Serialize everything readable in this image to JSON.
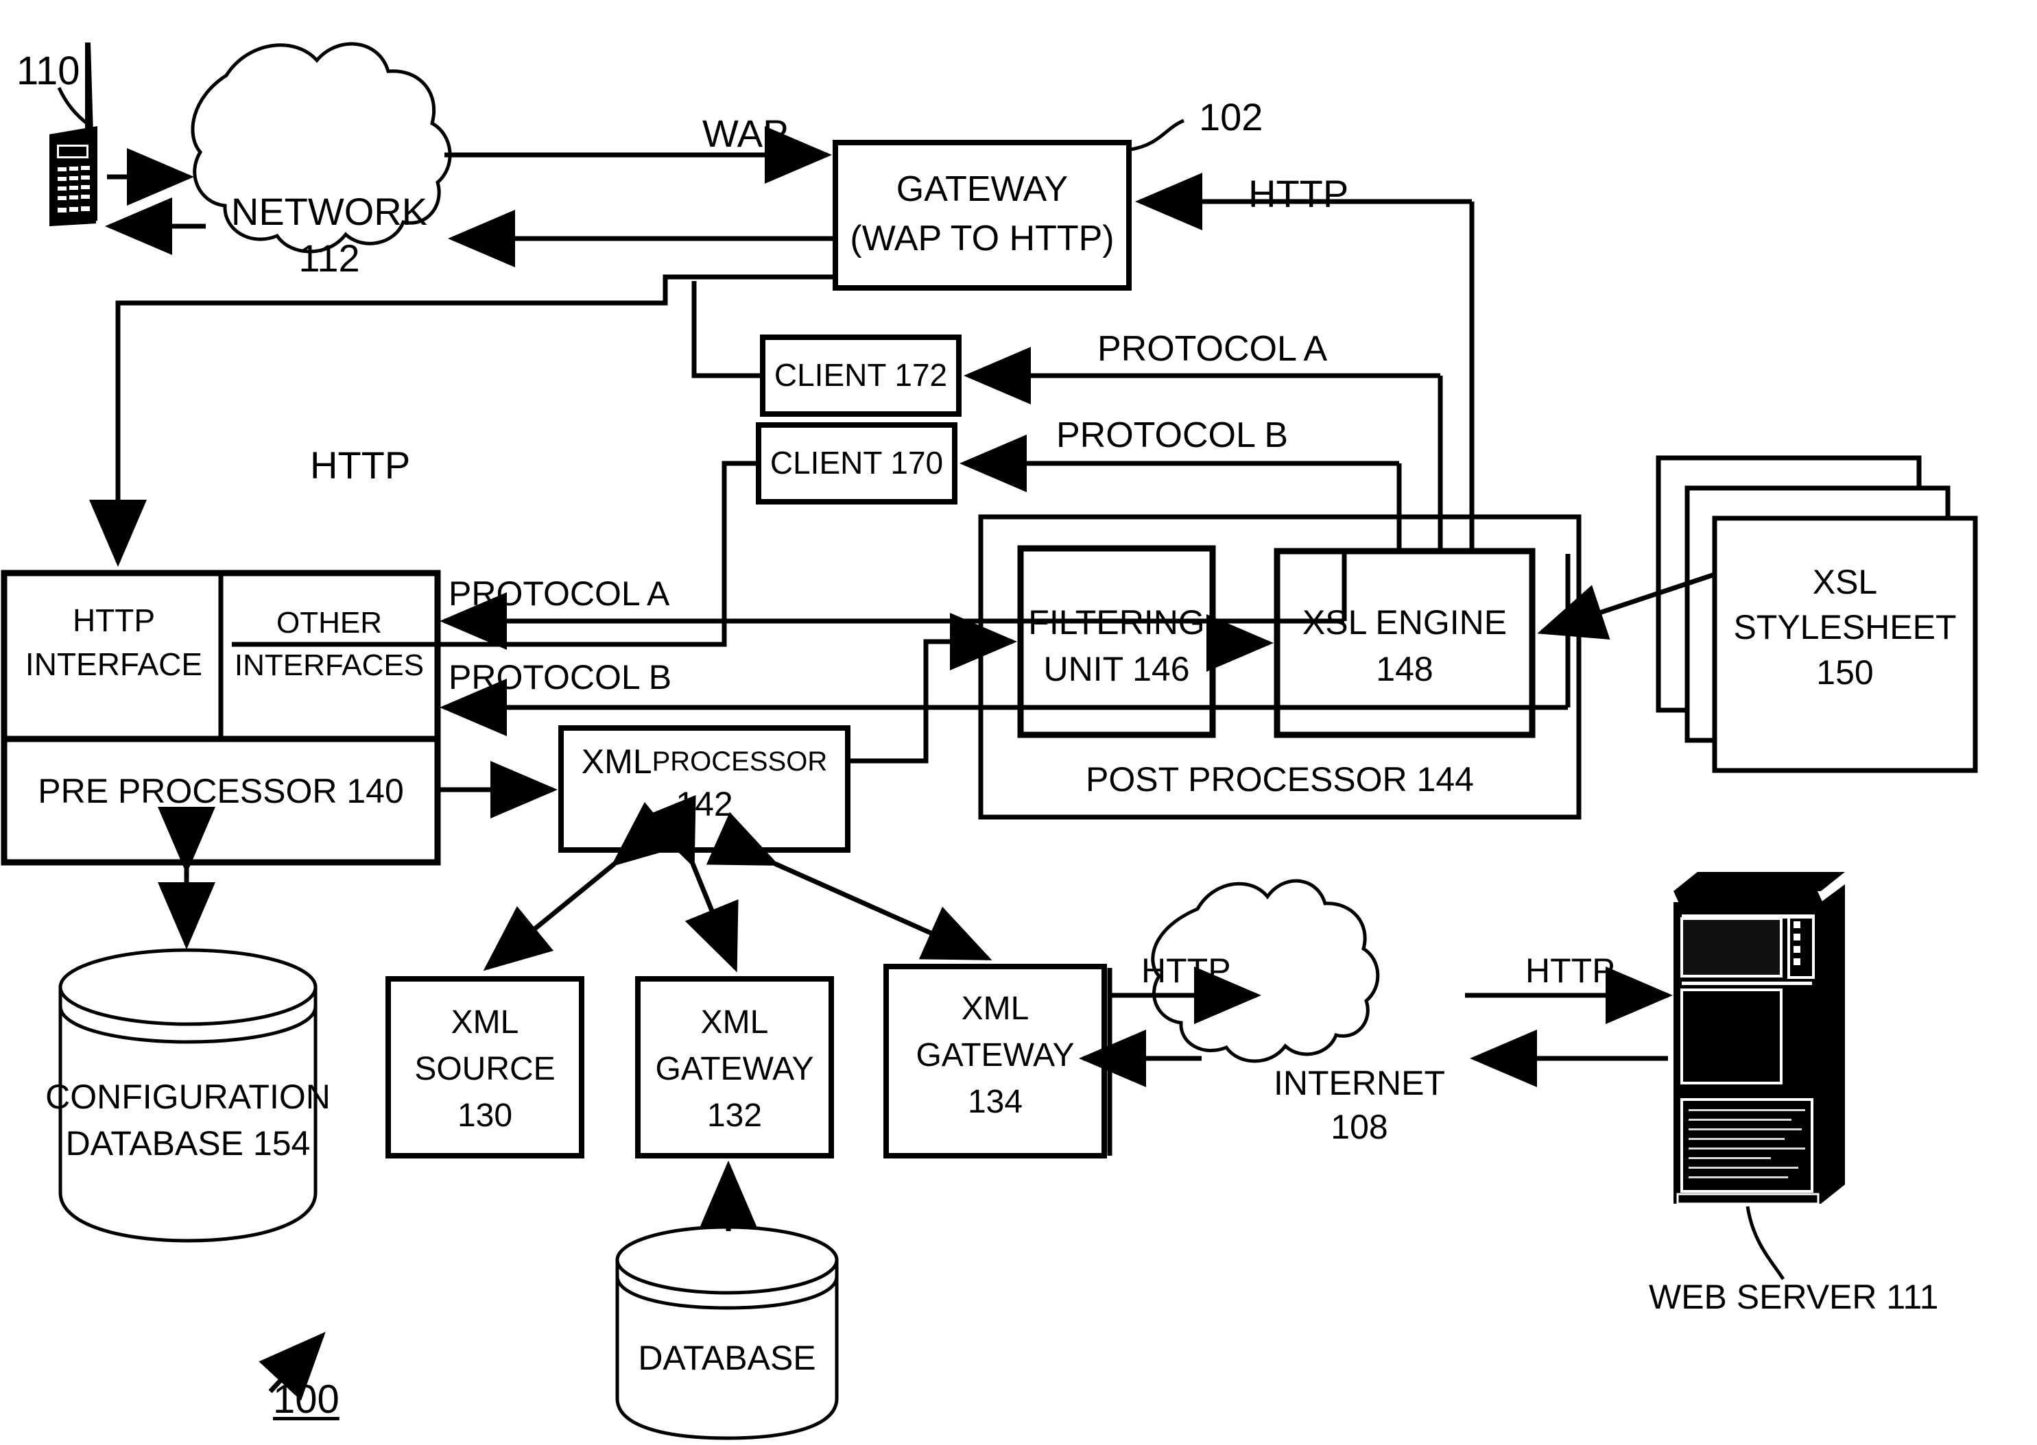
{
  "figure": {
    "number": "100",
    "title_ref": "100"
  },
  "nodes": {
    "mobile_device_ref": "110",
    "network": {
      "line1": "NETWORK",
      "line2": "112"
    },
    "gateway": {
      "line1": "GATEWAY",
      "line2": "(WAP TO HTTP)",
      "ref": "102"
    },
    "client_172": "CLIENT  172",
    "client_170": "CLIENT 170",
    "http_interface": {
      "line1": "HTTP",
      "line2": "INTERFACE"
    },
    "other_interfaces": {
      "line1": "OTHER",
      "line2": "INTERFACES"
    },
    "pre_processor": "PRE PROCESSOR 140",
    "xml_processor": {
      "line1_a": "XML ",
      "line1_b": "PROCESSOR",
      "line2": "142"
    },
    "filtering_unit": {
      "line1": "FILTERING",
      "line2": "UNIT 146"
    },
    "xsl_engine": {
      "line1": "XSL ENGINE",
      "line2": "148"
    },
    "post_processor": "POST PROCESSOR 144",
    "xsl_stylesheet": {
      "line1": "XSL",
      "line2": "STYLESHEET",
      "line3": "150"
    },
    "configuration_database": {
      "line1": "CONFIGURATION",
      "line2": "DATABASE 154"
    },
    "xml_source": {
      "line1": "XML",
      "line2": "SOURCE",
      "line3": "130"
    },
    "xml_gateway_132": {
      "line1": "XML",
      "line2": "GATEWAY",
      "line3": "132"
    },
    "xml_gateway_134": {
      "line1": "XML",
      "line2": "GATEWAY",
      "line3": "134"
    },
    "database": "DATABASE",
    "internet": {
      "line1": "INTERNET",
      "line2": "108"
    },
    "web_server": "WEB SERVER 111"
  },
  "edge_labels": {
    "wap": "WAP",
    "http_gateway_right": "HTTP",
    "http_left": "HTTP",
    "protocol_a_top": "PROTOCOL A",
    "protocol_b_top": "PROTOCOL B",
    "protocol_a_iface": "PROTOCOL A",
    "protocol_b_iface": "PROTOCOL B",
    "http_gw134_internet": "HTTP",
    "http_internet_server": "HTTP"
  },
  "colors": {
    "ink": "#000000",
    "paper": "#ffffff"
  }
}
